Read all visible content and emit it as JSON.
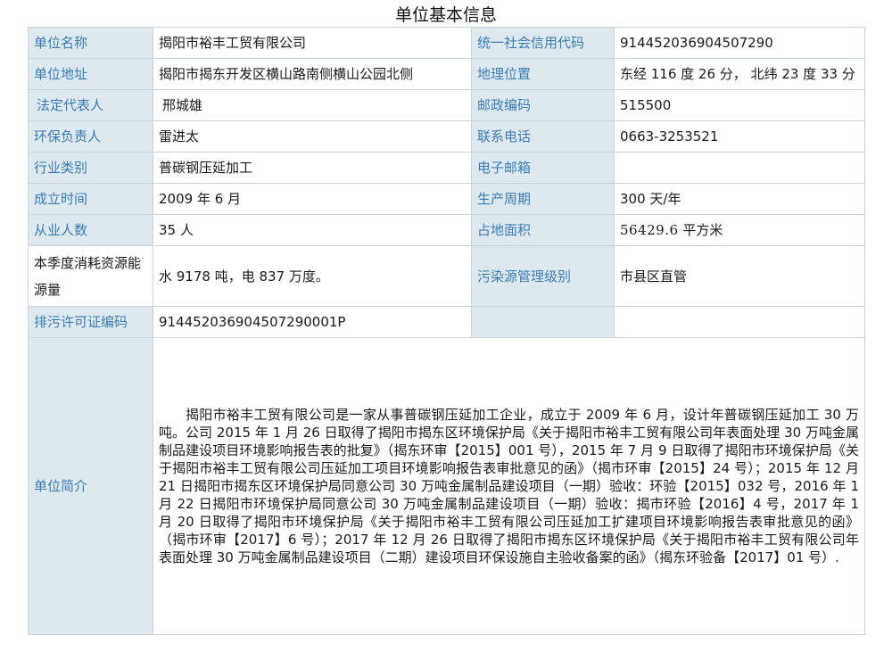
{
  "page_title": "单位基本信息",
  "rows": {
    "name": {
      "label": "单位名称",
      "value": "揭阳市裕丰工贸有限公司"
    },
    "credit_code": {
      "label": "统一社会信用代码",
      "value": "914452036904507290"
    },
    "address": {
      "label": "单位地址",
      "value": "揭阳市揭东开发区横山路南侧横山公园北侧"
    },
    "location": {
      "label": "地理位置",
      "value": "东经 116 度 26 分， 北纬 23 度 33 分"
    },
    "legal_rep": {
      "label": "法定代表人",
      "value": "邢城雄"
    },
    "postcode": {
      "label": "邮政编码",
      "value": "515500"
    },
    "env_officer": {
      "label": "环保负责人",
      "value": "雷进太"
    },
    "phone": {
      "label": "联系电话",
      "value": "0663-3253521"
    },
    "industry": {
      "label": "行业类别",
      "value": "普碳钢压延加工"
    },
    "email": {
      "label": "电子邮箱",
      "value": ""
    },
    "founded": {
      "label": "成立时间",
      "value": "2009 年 6 月"
    },
    "cycle": {
      "label": "生产周期",
      "value": "300 天/年"
    },
    "employees": {
      "label": "从业人数",
      "value": "35 人"
    },
    "area": {
      "label": "占地面积",
      "value_number": "56429.6",
      "value_unit": "平方米"
    },
    "consumption": {
      "label_line1": "本季度消耗资源能",
      "label_line2": "源量",
      "value": "水 9178 吨，电 837 万度。"
    },
    "pollution_level": {
      "label": "污染源管理级别",
      "value": "市县区直管"
    },
    "permit": {
      "label": "排污许可证编码",
      "value": "914452036904507290001P"
    }
  },
  "intro": {
    "label": "单位简介",
    "text": "揭阳市裕丰工贸有限公司是一家从事普碳钢压延加工企业，成立于 2009 年 6 月，设计年普碳钢压延加工 30 万吨。公司 2015 年 1 月 26 日取得了揭阳市揭东区环境保护局《关于揭阳市裕丰工贸有限公司年表面处理 30 万吨金属制品建设项目环境影响报告表的批复》（揭东环审【2015】001 号），2015 年 7 月 9 日取得了揭阳市环境保护局《关于揭阳市裕丰工贸有限公司压延加工项目环境影响报告表审批意见的函》（揭市环审【2015】24 号）；2015 年 12 月 21 日揭阳市揭东区环境保护局同意公司 30 万吨金属制品建设项目（一期）验收：环验【2015】032 号，2016 年 1 月 22 日揭阳市环境保护局同意公司 30 万吨金属制品建设项目（一期）验收：揭市环验【2016】4 号，2017 年 1 月 20 日取得了揭阳市环境保护局《关于揭阳市裕丰工贸有限公司压延加工扩建项目环境影响报告表审批意见的函》（揭市环审【2017】6 号）；2017 年 12 月 26 日取得了揭阳市揭东区环境保护局《关于揭阳市裕丰工贸有限公司年表面处理 30 万吨金属制品建设项目（二期）建设项目环保设施自主验收备案的函》（揭东环验备【2017】01 号）."
  }
}
